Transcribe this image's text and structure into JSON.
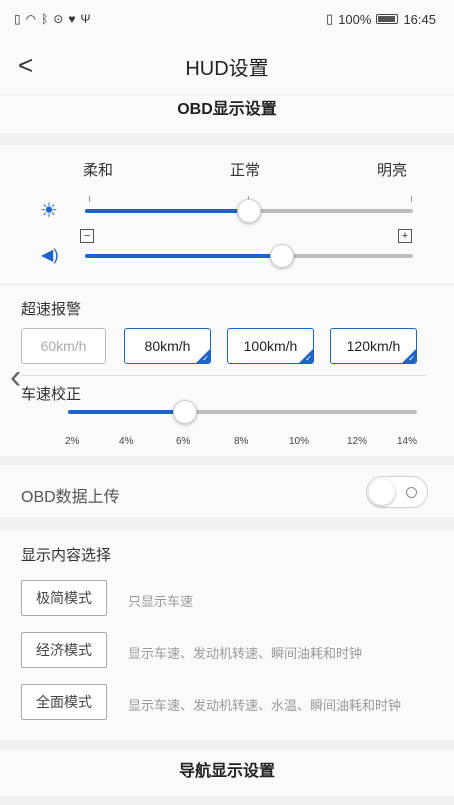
{
  "status": {
    "battery": "100%",
    "time": "16:45"
  },
  "header": {
    "back_glyph": "<",
    "title": "HUD设置"
  },
  "obd_section": {
    "title": "OBD显示设置"
  },
  "brightness": {
    "labels": [
      "柔和",
      "正常",
      "明亮"
    ],
    "level": 0.5
  },
  "volume": {
    "minus": "−",
    "plus": "+",
    "level": 0.6
  },
  "speed_alarm": {
    "label": "超速报警",
    "options": [
      {
        "label": "60km/h",
        "selected": false
      },
      {
        "label": "80km/h",
        "selected": true
      },
      {
        "label": "100km/h",
        "selected": true
      },
      {
        "label": "120km/h",
        "selected": true
      }
    ]
  },
  "speed_calib": {
    "label": "车速校正",
    "ticks": [
      "2%",
      "4%",
      "6%",
      "8%",
      "10%",
      "12%",
      "14%"
    ],
    "value": "6%"
  },
  "obd_upload": {
    "label": "OBD数据上传",
    "enabled": false
  },
  "display_content": {
    "label": "显示内容选择",
    "modes": [
      {
        "button": "极简模式",
        "desc": "只显示车速"
      },
      {
        "button": "经济模式",
        "desc": "显示车速、发动机转速、瞬间油耗和时钟"
      },
      {
        "button": "全面模式",
        "desc": "显示车速、发动机转速、水温、瞬间油耗和时钟"
      }
    ]
  },
  "nav_section": {
    "title": "导航显示设置"
  }
}
